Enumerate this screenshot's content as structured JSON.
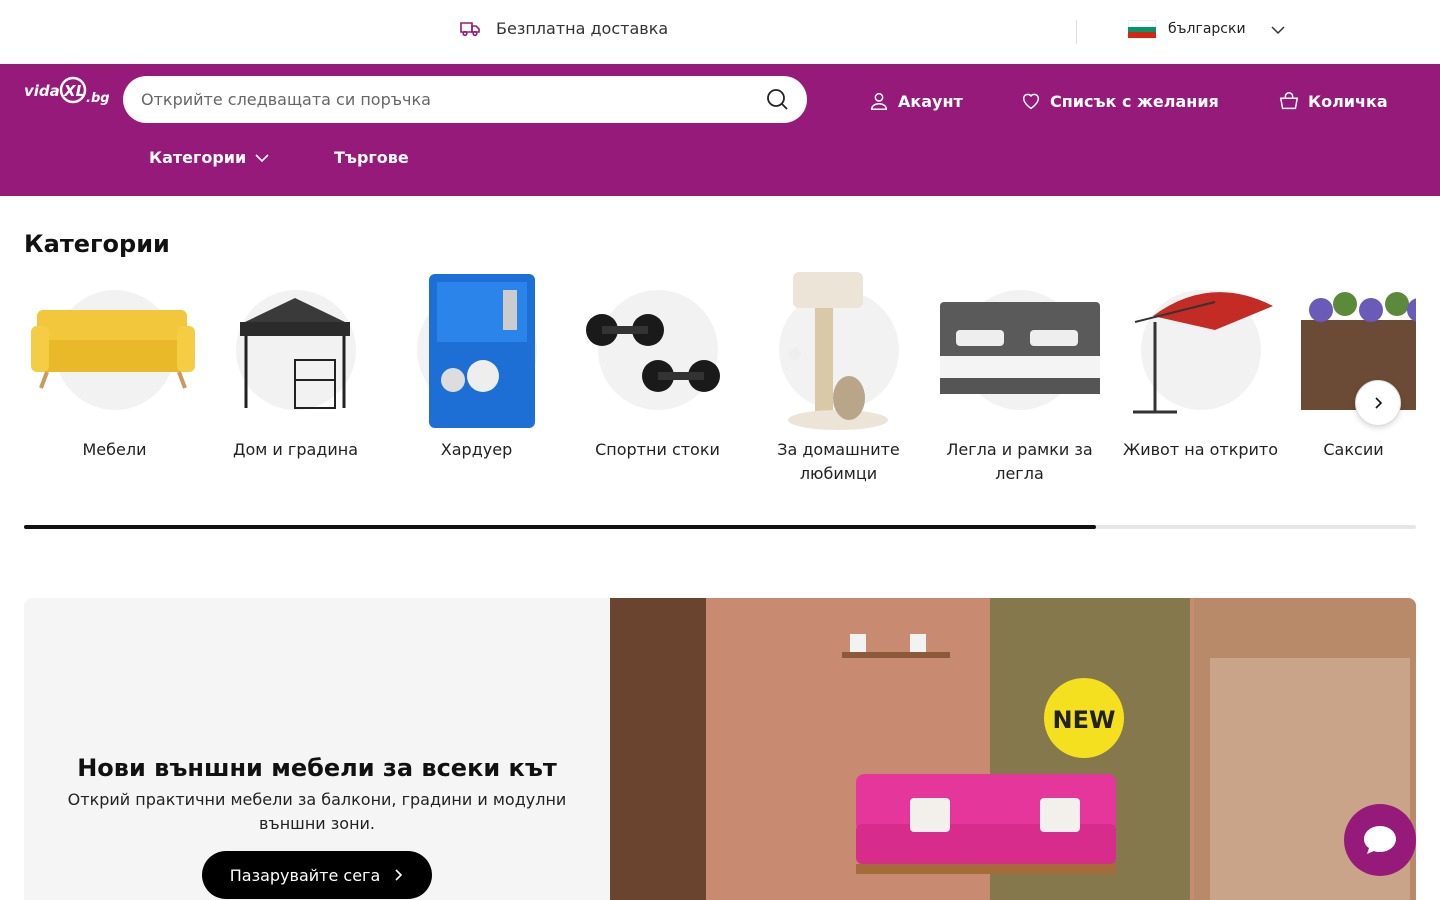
{
  "topbar": {
    "shipping_text": "Безплатна доставка",
    "shipping_icon": "truck-icon",
    "language": "български"
  },
  "header": {
    "brand": "vidaXL.bg",
    "search_placeholder": "Открийте следващата си поръчка",
    "account_label": "Акаунт",
    "wishlist_label": "Списък с желания",
    "cart_label": "Количка",
    "categories_label": "Категории",
    "auctions_label": "Търгове"
  },
  "colors": {
    "brand": "#951a7a",
    "accent": "#000000"
  },
  "categories": {
    "title": "Категории",
    "items": [
      {
        "label": "Мебели",
        "icon": "sofa"
      },
      {
        "label": "Дом и градина",
        "icon": "gazebo"
      },
      {
        "label": "Хардуер",
        "icon": "spray-gun-kit"
      },
      {
        "label": "Спортни стоки",
        "icon": "dumbbells"
      },
      {
        "label": "За домашните любимци",
        "icon": "cat-tree"
      },
      {
        "label": "Легла и рамки за легла",
        "icon": "bed"
      },
      {
        "label": "Живот на открито",
        "icon": "parasol"
      },
      {
        "label": "Саксии",
        "icon": "planters"
      }
    ],
    "scroll_progress": 0.77
  },
  "banner": {
    "title": "Нови външни мебели за всеки кът",
    "subtitle": "Открий практични мебели за балкони, градини и модулни външни зони.",
    "button_label": "Пазарувайте сега",
    "badge": "NEW"
  }
}
